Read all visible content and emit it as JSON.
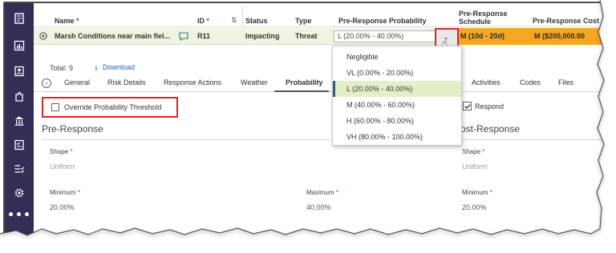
{
  "grid": {
    "headers": {
      "name": "Name",
      "id": "ID",
      "status": "Status",
      "type": "Type",
      "pre_response_probability": "Pre-Response Probability",
      "pre_response_schedule_line1": "Pre-Response",
      "pre_response_schedule_line2": "Schedule",
      "pre_response_cost": "Pre-Response Cost",
      "required_marker": "*"
    },
    "row": {
      "name": "Marsh Conditions near main fiel...",
      "id": "R11",
      "status": "Impacting",
      "type": "Threat",
      "probability": "L (20.00% - 40.00%)",
      "schedule": "M (10d - 20d)",
      "cost": "M ($200,000.00"
    }
  },
  "subbar": {
    "total": "Total:  9",
    "download": "Download"
  },
  "tabs": [
    "General",
    "Risk Details",
    "Response Actions",
    "Weather",
    "Probability",
    "Activities",
    "Codes",
    "Files"
  ],
  "active_tab": "Probability",
  "override": {
    "label": "Override Probability Threshold",
    "checked": false
  },
  "respond": {
    "label": "Respond",
    "checked": true
  },
  "pre_response": {
    "title": "Pre-Response",
    "shape_label": "Shape",
    "shape_value": "Uniform",
    "minimum_label": "Minimum",
    "minimum_value": "20.00%",
    "maximum_label": "Maximum",
    "maximum_value": "40.00%"
  },
  "post_response": {
    "title": "Post-Response",
    "shape_label": "Shape",
    "shape_value": "Uniform",
    "minimum_label": "Minimum",
    "minimum_value": "20.00%"
  },
  "probability_options": [
    "Negligible",
    "VL (0.00% - 20.00%)",
    "L (20.00% - 40.00%)",
    "M (40.00% - 60.00%)",
    "H (60.00% - 80.00%)",
    "VH (80.00% - 100.00%)"
  ],
  "selected_option": "L (20.00% - 40.00%)",
  "colors": {
    "nav_rail": "#322e55",
    "row_highlight": "#eef4df",
    "schedule_cost_fill": "#f5a623",
    "callout_red": "#d02b2b",
    "selected_option_bg": "#e3efc6",
    "link_blue": "#1f5fbf"
  },
  "icons": {
    "nav": [
      "dashboard-icon",
      "chart-icon",
      "contacts-icon",
      "puzzle-icon",
      "bank-icon",
      "checklist-icon",
      "task-list-icon",
      "settings-icon",
      "more-icon"
    ],
    "row": [
      "gear-icon",
      "comment-icon"
    ],
    "dropdown": "chevron-down-icon",
    "cursor": "hand-cursor-icon"
  }
}
